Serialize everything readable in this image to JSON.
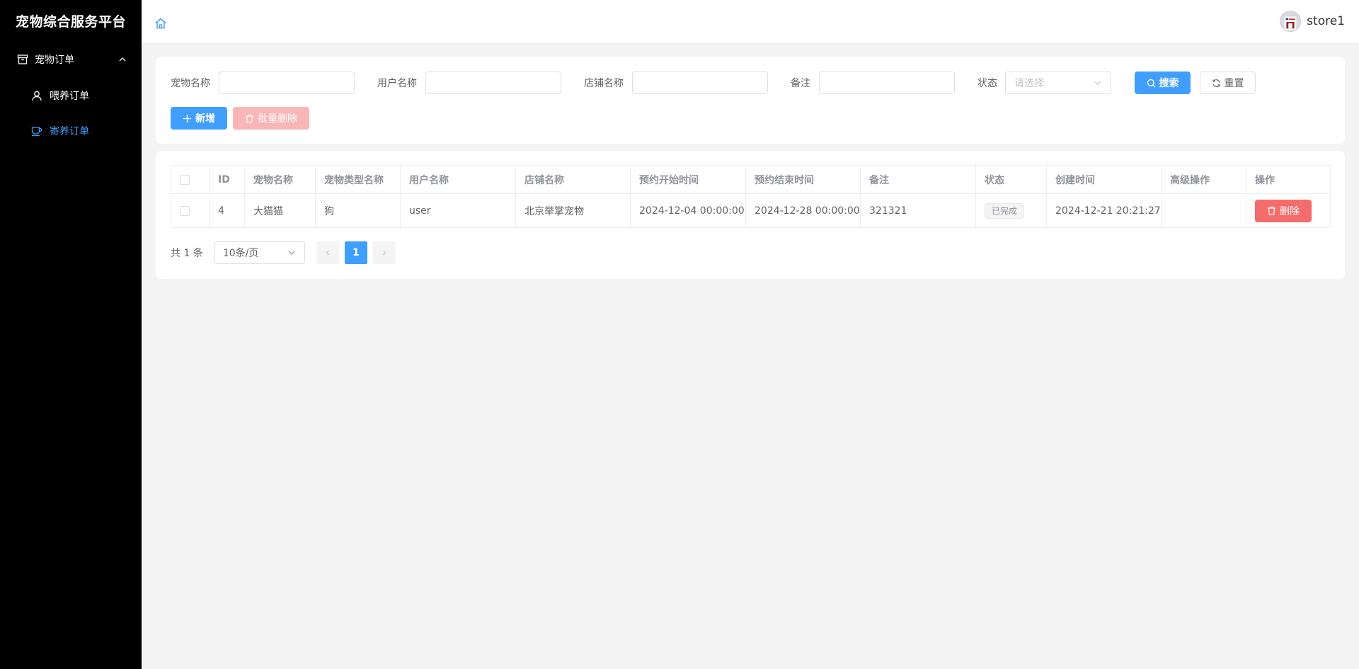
{
  "app": {
    "title": "宠物综合服务平台"
  },
  "sidebar": {
    "group": {
      "label": "宠物订单",
      "icon": "box-icon"
    },
    "items": [
      {
        "label": "喂养订单",
        "icon": "user-icon",
        "active": false
      },
      {
        "label": "寄养订单",
        "icon": "cup-icon",
        "active": true
      }
    ]
  },
  "header": {
    "username": "store1"
  },
  "search": {
    "pet_name_label": "宠物名称",
    "user_name_label": "用户名称",
    "store_name_label": "店铺名称",
    "remark_label": "备注",
    "status_label": "状态",
    "status_placeholder": "请选择",
    "search_button": "搜索",
    "reset_button": "重置",
    "add_button": "新增",
    "batch_delete_button": "批量删除"
  },
  "table": {
    "columns": [
      "ID",
      "宠物名称",
      "宠物类型名称",
      "用户名称",
      "店铺名称",
      "预约开始时间",
      "预约结束时间",
      "备注",
      "状态",
      "创建时间",
      "高级操作",
      "操作"
    ],
    "rows": [
      {
        "id": "4",
        "pet_name": "大猫猫",
        "pet_type": "狗",
        "user_name": "user",
        "store_name": "北京举掌宠物",
        "start_time": "2024-12-04 00:00:00",
        "end_time": "2024-12-28 00:00:00",
        "remark": "321321",
        "status": "已完成",
        "created_at": "2024-12-21 20:21:27",
        "advanced": "",
        "delete_label": "删除"
      }
    ]
  },
  "pagination": {
    "total_text": "共 1 条",
    "page_size": "10条/页",
    "current_page": "1"
  },
  "colors": {
    "primary": "#409eff",
    "danger": "#f56c6c",
    "sidebar_bg": "#000000"
  }
}
